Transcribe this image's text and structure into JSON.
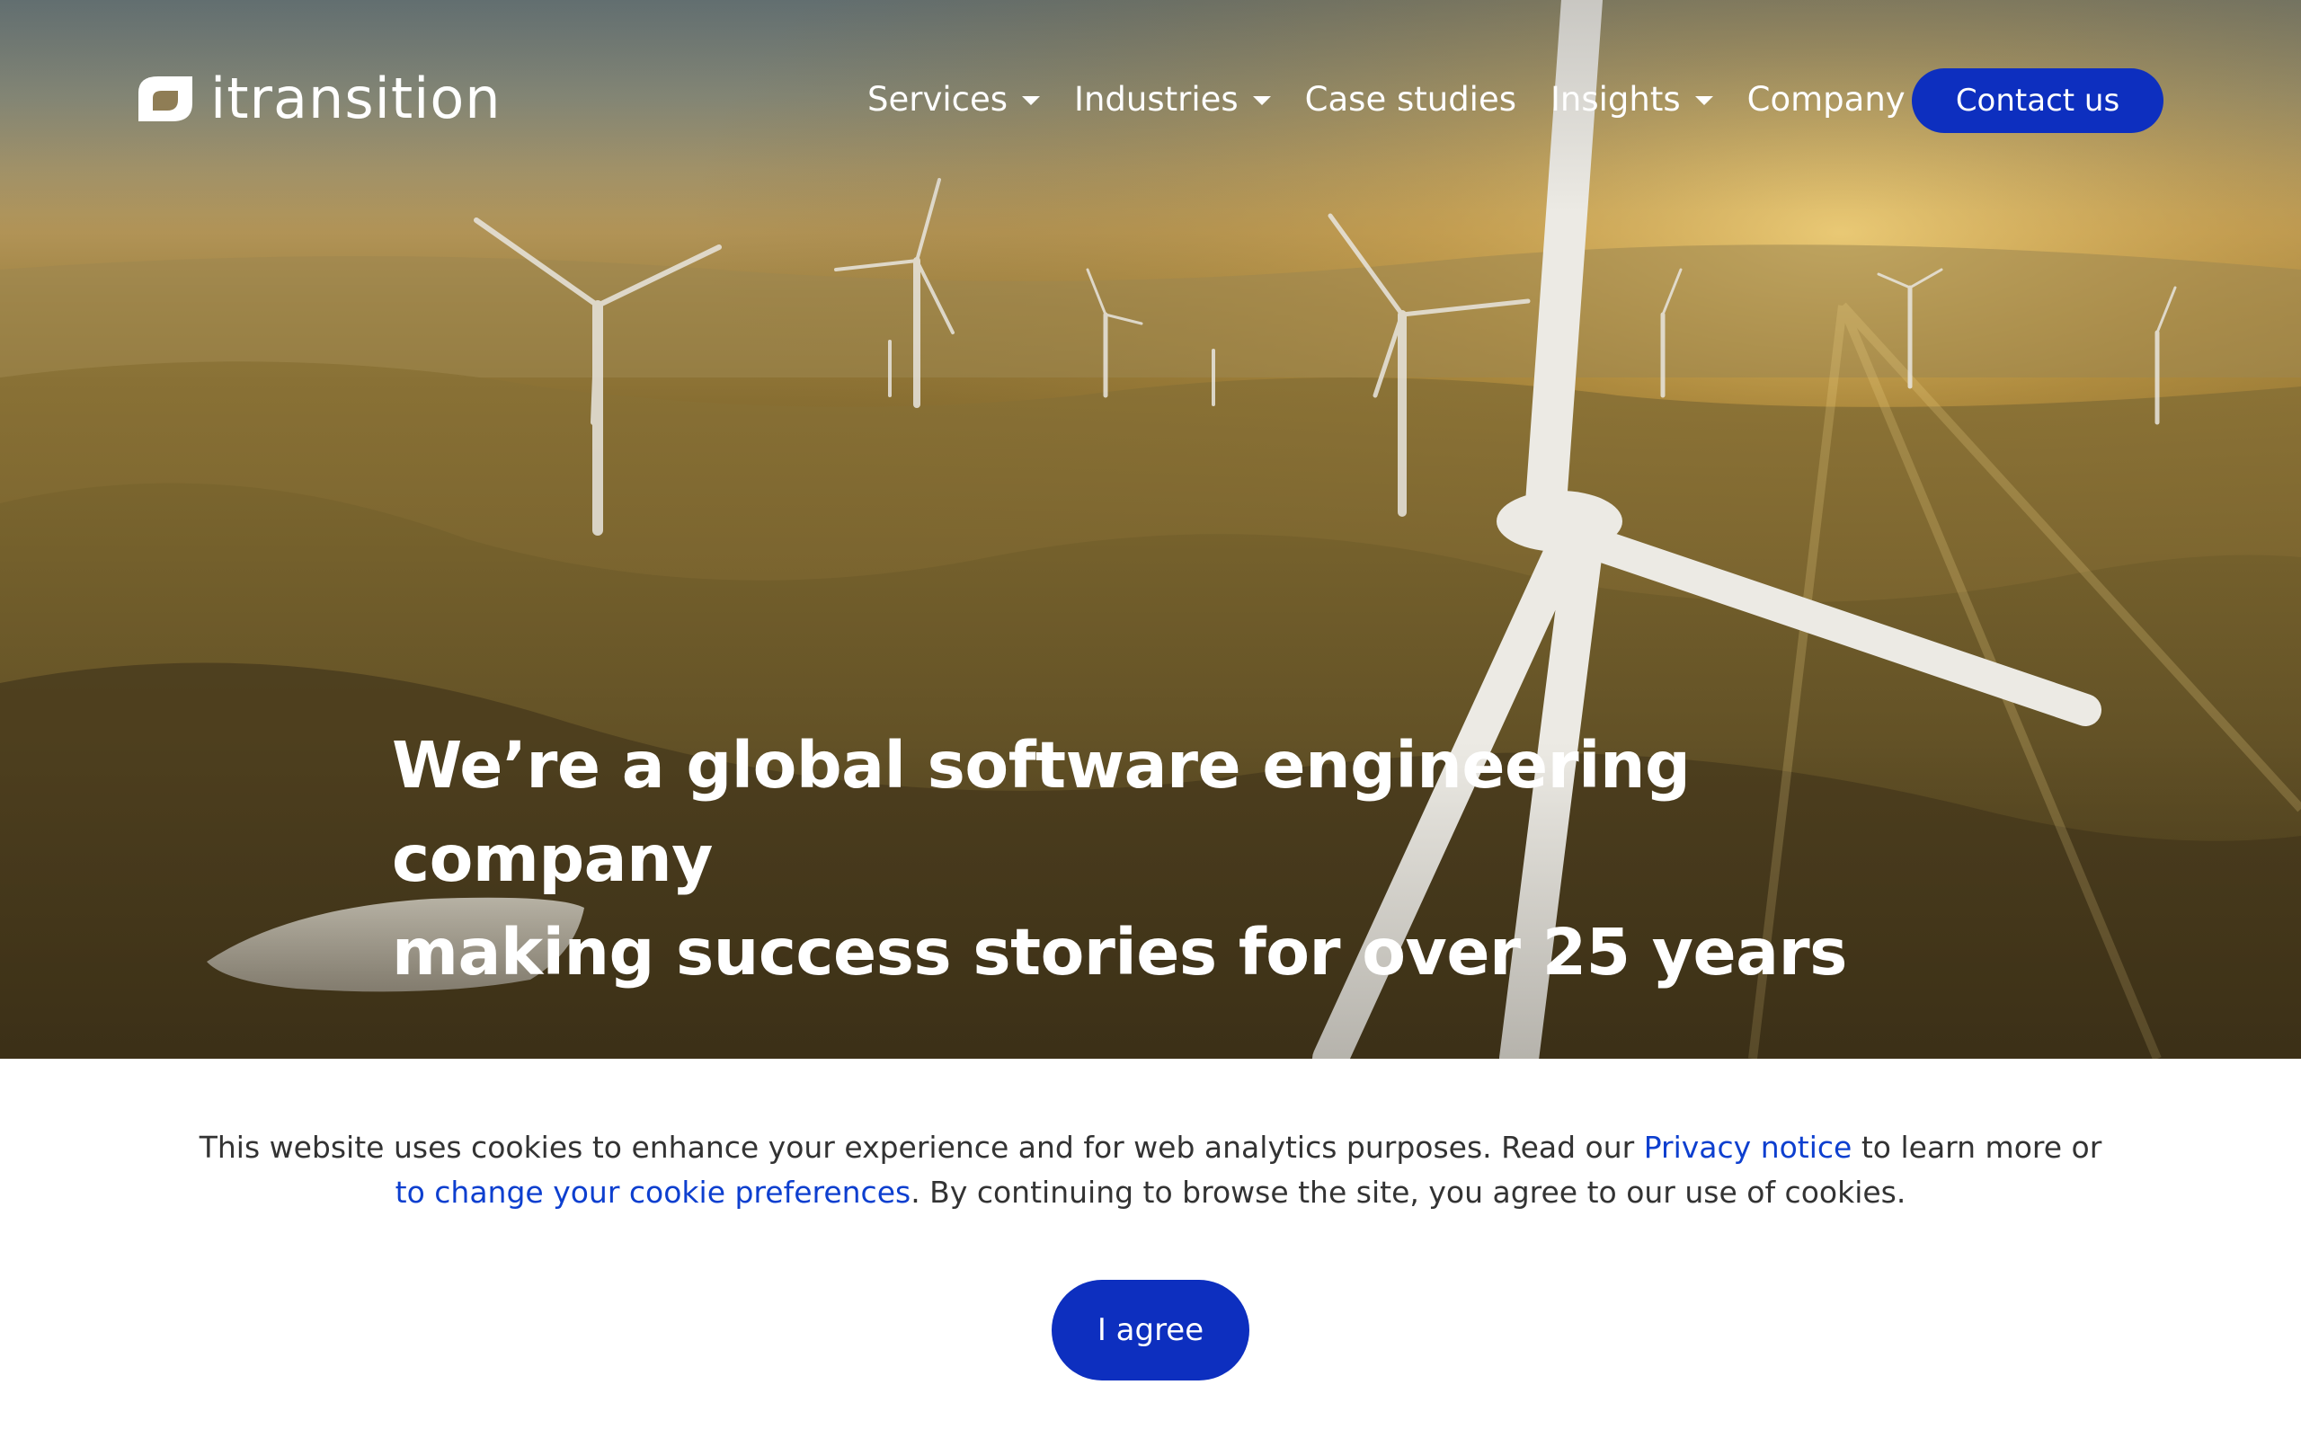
{
  "brand": {
    "name": "itransition",
    "logo_icon": "leaf-logo-icon"
  },
  "nav": {
    "items": [
      {
        "label": "Services",
        "has_dropdown": true
      },
      {
        "label": "Industries",
        "has_dropdown": true
      },
      {
        "label": "Case studies",
        "has_dropdown": false
      },
      {
        "label": "Insights",
        "has_dropdown": true
      },
      {
        "label": "Company",
        "has_dropdown": true
      }
    ],
    "cta_label": "Contact us"
  },
  "hero": {
    "headline_line1": "We’re a global software engineering company",
    "headline_line2": "making success stories for over 25 years",
    "background": "wind-turbines-landscape-image"
  },
  "cookie_banner": {
    "text_part1": "This website uses cookies to enhance your experience and for web analytics purposes. Read our ",
    "privacy_link": "Privacy notice",
    "text_part2": " to learn more or ",
    "preferences_link": "to change your cookie preferences",
    "text_part3": ". By continuing to browse the site, you agree to our use of cookies.",
    "agree_label": "I agree"
  },
  "colors": {
    "primary_button": "#0d2fbf",
    "link": "#0d3fcf",
    "banner_text": "#333333"
  }
}
